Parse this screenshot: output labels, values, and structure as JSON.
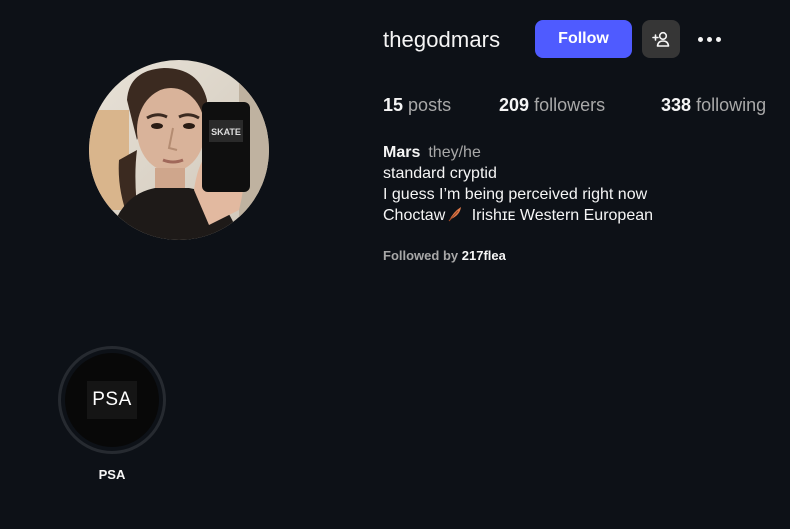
{
  "profile": {
    "username": "thegodmars",
    "follow_label": "Follow",
    "stats": {
      "posts_count": "15",
      "posts_label": "posts",
      "followers_count": "209",
      "followers_label": "followers",
      "following_count": "338",
      "following_label": "following"
    },
    "bio": {
      "name": "Mars",
      "pronouns": "they/he",
      "line1": "standard cryptid",
      "line2": "I guess I’m being perceived right now",
      "line3_prefix": "Choctaw",
      "line3_suffix": " Irishɪᴇ Western European"
    },
    "followed_by_prefix": "Followed by",
    "followed_by_user": "217flea"
  },
  "highlights": [
    {
      "title": "PSA",
      "cover_text": "PSA"
    }
  ],
  "icons": {
    "suggest": "add-person-icon",
    "more": "more-options-icon",
    "emoji": "feather-emoji-icon"
  },
  "colors": {
    "background": "#0d1117",
    "follow_button": "#4f5bff",
    "secondary_button": "#363636",
    "muted_text": "#a8a8a8"
  }
}
